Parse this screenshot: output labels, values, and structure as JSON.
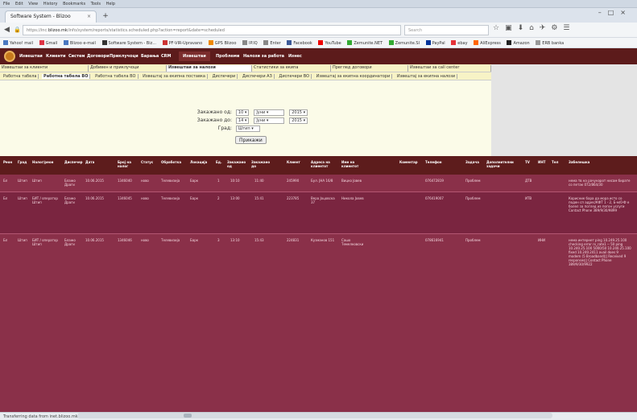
{
  "browser": {
    "menu": [
      "File",
      "Edit",
      "View",
      "History",
      "Bookmarks",
      "Tools",
      "Help"
    ],
    "tab_title": "Software System - Blizoo",
    "new_tab": "+",
    "url_domain": "blizoo.mk",
    "url_prefix": "https://inc.",
    "url_rest": "/info/system/reports/statistics.scheduled.php?action=report&date=scheduled",
    "search_placeholder": "Search",
    "bookmarks": [
      "Yahoo! mail",
      "Gmail",
      "Blizoo e-mail",
      "Software System - Biz...",
      "PF-VIR-Upravano",
      "GPS Blizoo",
      "IP.IQ",
      "Enter",
      "Facebook",
      "YouTube",
      "Zemunite.NET",
      "Zemunite.SI",
      "PayPal",
      "ebay",
      "AliExpress",
      "Amazon",
      "ERB banka"
    ],
    "status_text": "Transferring data from inet.blizoo.mk..."
  },
  "app_nav": {
    "items": [
      "Извештаи",
      "Клиенти",
      "Систем",
      "Договори",
      "Приклучоци",
      "Барања",
      "CRM",
      "Извештаи",
      "Проблеми",
      "Налози за работа",
      "Изнес"
    ],
    "active_index": 7
  },
  "subtabs_row1": [
    "Извештаи за клиенти",
    "Добивен и приклучоци",
    "Извештаи за налози",
    "Статистики за екипа",
    "Преглед договори",
    "Извештаи за call center"
  ],
  "subtabs_row1_selected": 2,
  "subtabs_row2": [
    "Работна табела",
    "Работна табела ВО",
    "Работна табела ВО",
    "Извештај за екипна поставка",
    "Диспечери",
    "Диспечери АЗ",
    "Диспечери ВО",
    "Извештај за екипна координатори",
    "Извештај за екипна налози"
  ],
  "subtabs_row2_selected": 1,
  "form": {
    "from_label": "Закажано од:",
    "from_day": "10",
    "from_month": "Јуни",
    "from_year": "2015",
    "to_label": "Закажано до:",
    "to_day": "14",
    "to_month": "Јуни",
    "to_year": "2015",
    "city_label": "Град:",
    "city_value": "Штип",
    "show_button": "Прикажи"
  },
  "table": {
    "headers": [
      "Реон",
      "Град",
      "Налог/реон",
      "Диспечер",
      "Дата",
      "Број на налог",
      "Статус",
      "Обработка",
      "Локација",
      "Ед.",
      "Закажано од",
      "Закажано до",
      "Клиент",
      "Адреса на клиентот",
      "Име на клиентот",
      "Коментар",
      "Телефон",
      "Задача",
      "Дополнителни задачи",
      "TV",
      "ИНТ",
      "Тел",
      "Забелешка"
    ],
    "rows": [
      {
        "reon": "Бл",
        "grad": "Штип",
        "nalog": "Штип",
        "dispecer": "Блажо Драги",
        "data": "10.06.2015",
        "broj": "1346040",
        "status": "ново",
        "obrabotka": "Телевизија",
        "lokacija": "Барк",
        "ed": "1",
        "od": "10:10",
        "do": "11:40",
        "klient": "245990",
        "adresa": "Бул. ЈНА 16/8",
        "ime": "Вицко Јовев",
        "komentar": "",
        "telefon": "076472819",
        "zadaca": "Проблем",
        "dop": "",
        "tv": "ДТВ",
        "int": "",
        "tel": "",
        "zab": "нема тв на рачунарот нисам бирате со петак 072/864/30"
      },
      {
        "reon": "Бл",
        "grad": "Штип",
        "nalog": "БИТ / оператор Штип",
        "dispecer": "Блажо Драги",
        "data": "10.06.2015",
        "broj": "1346045",
        "status": "ново",
        "obrabotka": "Телевизија",
        "lokacija": "Барк",
        "ed": "2",
        "od": "13:00",
        "do": "15:41",
        "klient": "223785",
        "adresa": "Вера Јоцовска 37",
        "ime": "Никола Јовев",
        "komentar": "",
        "telefon": "076419007",
        "zadaca": "Проблем",
        "dop": "",
        "tv": "ИТВ",
        "int": "",
        "tel": "",
        "zab": "Корисник бара да мора исто со поден сп адрес/КФТ 1 - 2, Б-м/0-Ф е болел за поглед из погон услуги Contact Phone 389/9/30/9899"
      },
      {
        "reon": "Бл",
        "grad": "Штип",
        "nalog": "БИТ / оператор Штип",
        "dispecer": "Блажо Драги",
        "data": "10.06.2015",
        "broj": "1346046",
        "status": "ново",
        "obrabotka": "Телевизија",
        "lokacija": "Барк",
        "ed": "3",
        "od": "13:10",
        "do": "15:43",
        "klient": "224831",
        "adresa": "Кузманов 151",
        "ime": "Сашо Темелковски",
        "komentar": "",
        "telefon": "078616941",
        "zadaca": "Проблем",
        "dop": "",
        "tv": "",
        "int": "ИНИ",
        "tel": "",
        "zab": "нема интернет ping 10.249.25.100 checking error rx_rate1 -- 50 ping 10.240.25.100 5000/50 10.240.25.100 fixed 10.240.2411 avail does 9 modem (5 Broadband)|| Received 9 responses|| Contact Phone 389/9/30/9922"
      }
    ]
  },
  "colors": {
    "app_nav": "#5c1b1b",
    "table_header": "#5d1c1c",
    "table_body": "#8a3049",
    "subtabs_bg": "#f7f3c6",
    "form_bg": "#fbfbe8"
  }
}
